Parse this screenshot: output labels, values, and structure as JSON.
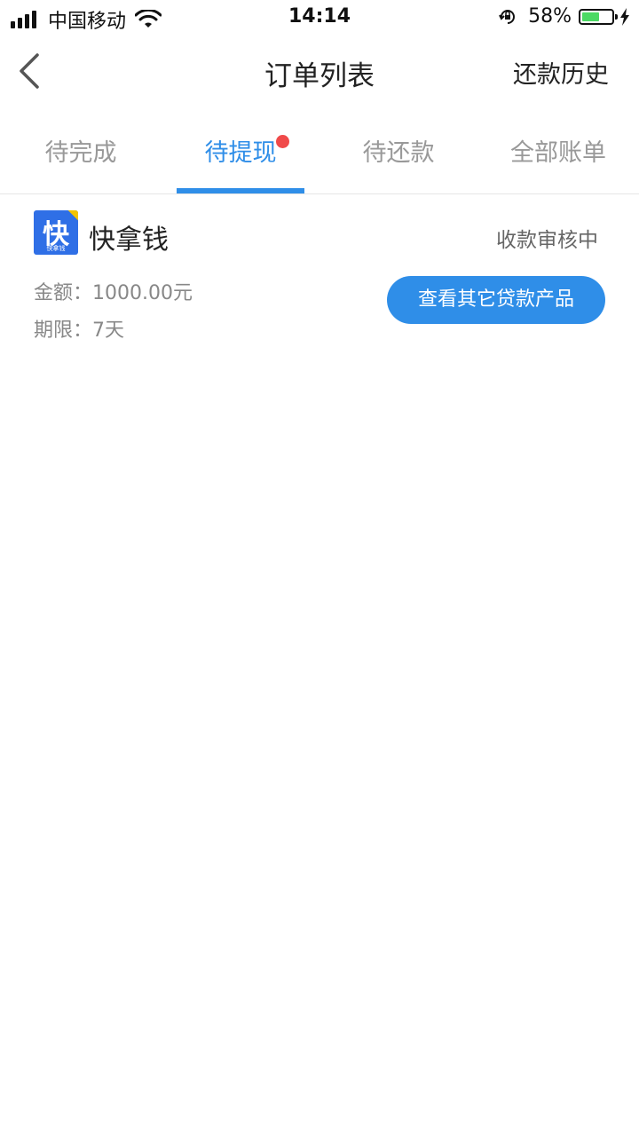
{
  "status_bar": {
    "carrier": "中国移动",
    "time": "14:14",
    "battery_percent": "58%",
    "battery_level": 0.58,
    "icons": [
      "signal-icon",
      "wifi-icon",
      "rotation-lock-icon",
      "battery-icon",
      "charging-icon"
    ]
  },
  "nav": {
    "title": "订单列表",
    "right_action": "还款历史",
    "back_icon": "chevron-left-icon"
  },
  "tabs": [
    {
      "label": "待完成",
      "active": false
    },
    {
      "label": "待提现",
      "active": true,
      "badge": true
    },
    {
      "label": "待还款",
      "active": false
    },
    {
      "label": "全部账单",
      "active": false
    }
  ],
  "colors": {
    "accent": "#2f8ee8",
    "badge": "#f04a4a",
    "logo_blue": "#2f6fe6",
    "logo_corner": "#f2c300"
  },
  "order": {
    "product_name": "快拿钱",
    "logo_glyph": "快",
    "logo_mini_text": "快拿钱",
    "status": "收款审核中",
    "amount_label": "金额：",
    "amount_value": "1000.00元",
    "term_label": "期限：",
    "term_value": "7天",
    "cta_label": "查看其它贷款产品"
  }
}
